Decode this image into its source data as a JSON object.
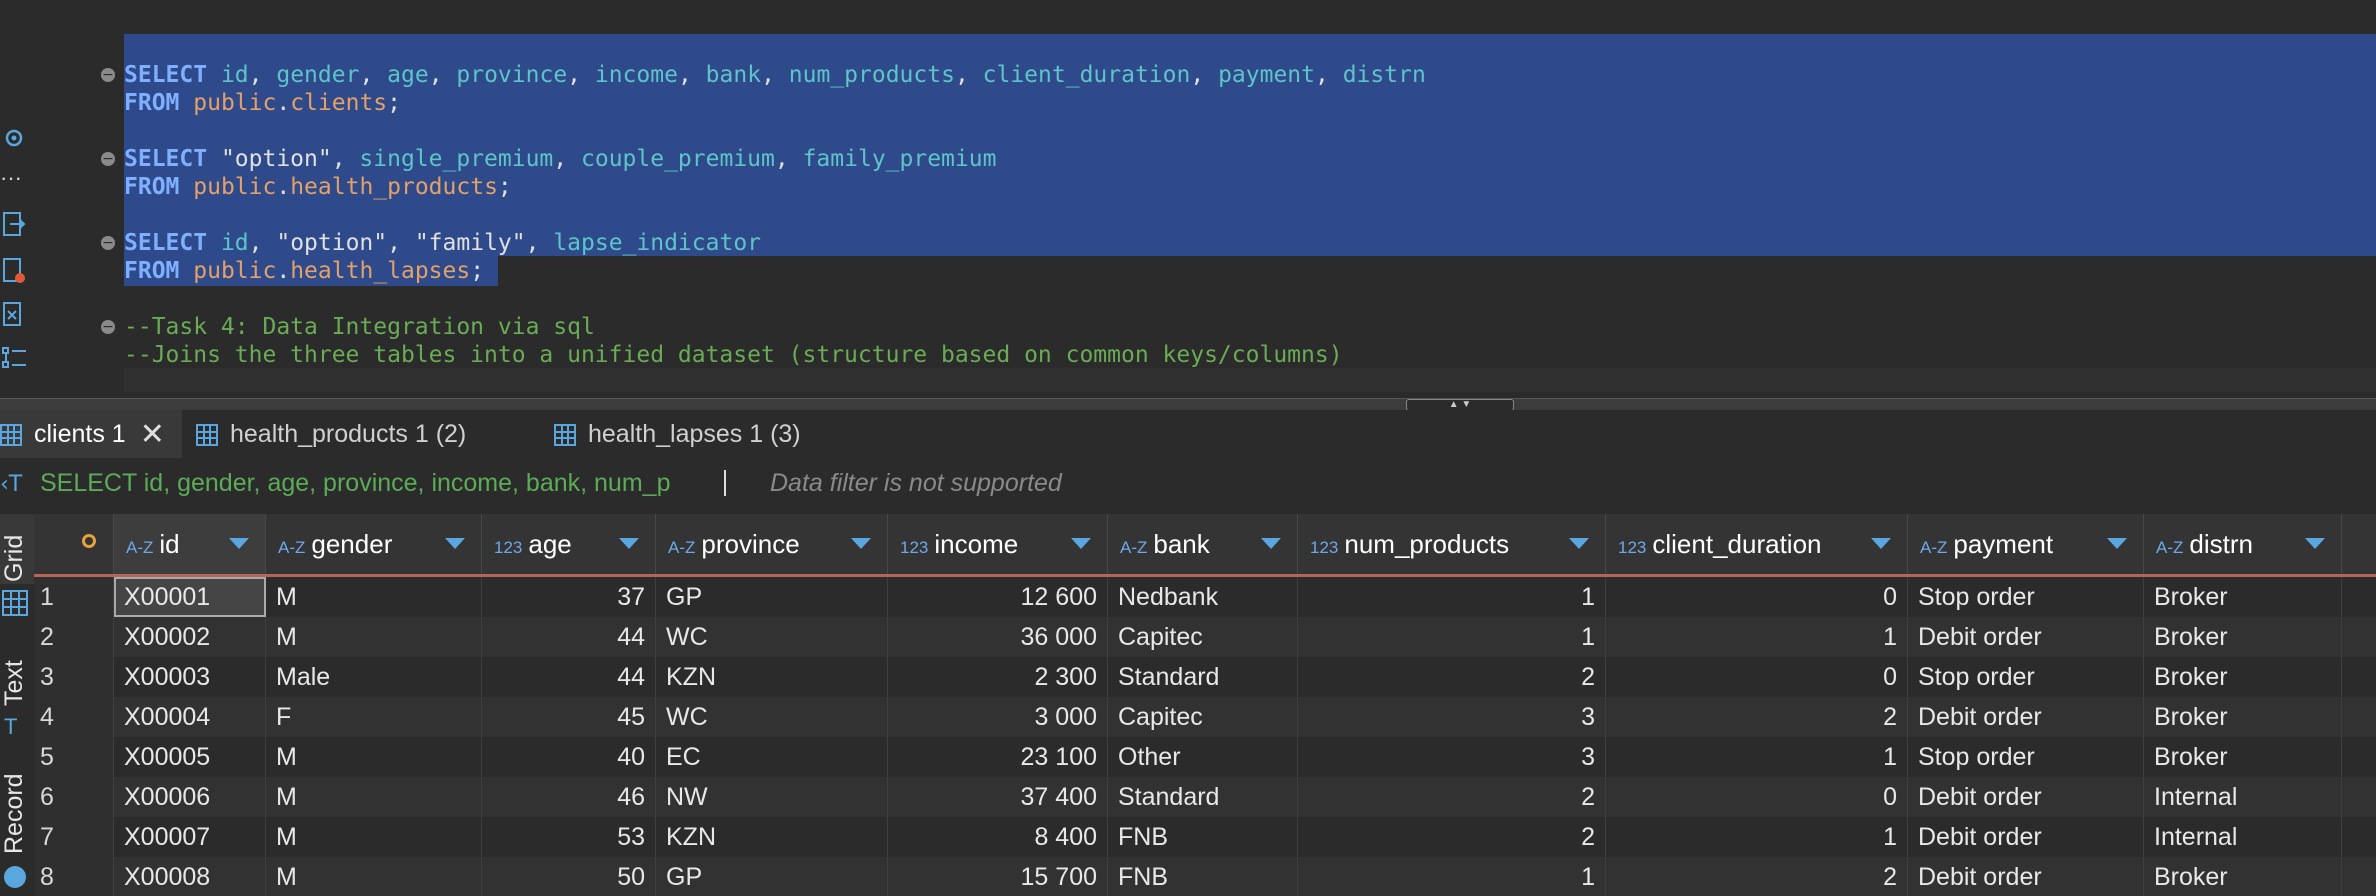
{
  "editor": {
    "lines": [
      {
        "parts": [
          [
            "kw",
            "SELECT "
          ],
          [
            "col",
            "id"
          ],
          [
            "plain",
            ", "
          ],
          [
            "col",
            "gender"
          ],
          [
            "plain",
            ", "
          ],
          [
            "col",
            "age"
          ],
          [
            "plain",
            ", "
          ],
          [
            "col",
            "province"
          ],
          [
            "plain",
            ", "
          ],
          [
            "col",
            "income"
          ],
          [
            "plain",
            ", "
          ],
          [
            "col",
            "bank"
          ],
          [
            "plain",
            ", "
          ],
          [
            "col",
            "num_products"
          ],
          [
            "plain",
            ", "
          ],
          [
            "col",
            "client_duration"
          ],
          [
            "plain",
            ", "
          ],
          [
            "col",
            "payment"
          ],
          [
            "plain",
            ", "
          ],
          [
            "col",
            "distrn"
          ]
        ]
      },
      {
        "parts": [
          [
            "kw",
            "FROM "
          ],
          [
            "tbl",
            "public"
          ],
          [
            "plain",
            "."
          ],
          [
            "tbl",
            "clients"
          ],
          [
            "plain",
            ";"
          ]
        ]
      },
      {
        "parts": [
          [
            "kw",
            "SELECT "
          ],
          [
            "str",
            "\"option\""
          ],
          [
            "plain",
            ", "
          ],
          [
            "col",
            "single_premium"
          ],
          [
            "plain",
            ", "
          ],
          [
            "col",
            "couple_premium"
          ],
          [
            "plain",
            ", "
          ],
          [
            "col",
            "family_premium"
          ]
        ]
      },
      {
        "parts": [
          [
            "kw",
            "FROM "
          ],
          [
            "tbl",
            "public"
          ],
          [
            "plain",
            "."
          ],
          [
            "tbl",
            "health_products"
          ],
          [
            "plain",
            ";"
          ]
        ]
      },
      {
        "parts": [
          [
            "kw",
            "SELECT "
          ],
          [
            "col",
            "id"
          ],
          [
            "plain",
            ", "
          ],
          [
            "str",
            "\"option\""
          ],
          [
            "plain",
            ", "
          ],
          [
            "str",
            "\"family\""
          ],
          [
            "plain",
            ", "
          ],
          [
            "col",
            "lapse_indicator"
          ]
        ]
      },
      {
        "parts": [
          [
            "kw",
            "FROM "
          ],
          [
            "tbl",
            "public"
          ],
          [
            "plain",
            "."
          ],
          [
            "tbl",
            "health_lapses"
          ],
          [
            "plain",
            ";"
          ]
        ]
      },
      {
        "parts": [
          [
            "cmt",
            "--Task 4: Data Integration via sql"
          ]
        ]
      },
      {
        "parts": [
          [
            "cmt",
            "--Joins the three tables into a unified dataset (structure based on common keys/columns)"
          ]
        ]
      }
    ]
  },
  "tabs": [
    {
      "label": "clients 1",
      "active": true,
      "closable": true
    },
    {
      "label": "health_products 1 (2)",
      "active": false
    },
    {
      "label": "health_lapses 1 (3)",
      "active": false
    }
  ],
  "filter": {
    "query": "SELECT id, gender, age, province, income, bank, num_p",
    "note": "Data filter is not supported"
  },
  "side_tabs": [
    "Grid",
    "Text",
    "Record"
  ],
  "grid": {
    "columns": [
      {
        "name": "id",
        "type": "A-Z"
      },
      {
        "name": "gender",
        "type": "A-Z"
      },
      {
        "name": "age",
        "type": "123"
      },
      {
        "name": "province",
        "type": "A-Z"
      },
      {
        "name": "income",
        "type": "123"
      },
      {
        "name": "bank",
        "type": "A-Z"
      },
      {
        "name": "num_products",
        "type": "123"
      },
      {
        "name": "client_duration",
        "type": "123"
      },
      {
        "name": "payment",
        "type": "A-Z"
      },
      {
        "name": "distrn",
        "type": "A-Z"
      }
    ],
    "rows": [
      [
        "1",
        "X00001",
        "M",
        "37",
        "GP",
        "12 600",
        "Nedbank",
        "1",
        "0",
        "Stop order",
        "Broker"
      ],
      [
        "2",
        "X00002",
        "M",
        "44",
        "WC",
        "36 000",
        "Capitec",
        "1",
        "1",
        "Debit order",
        "Broker"
      ],
      [
        "3",
        "X00003",
        "Male",
        "44",
        "KZN",
        "2 300",
        "Standard",
        "2",
        "0",
        "Stop order",
        "Broker"
      ],
      [
        "4",
        "X00004",
        "F",
        "45",
        "WC",
        "3 000",
        "Capitec",
        "3",
        "2",
        "Debit order",
        "Broker"
      ],
      [
        "5",
        "X00005",
        "M",
        "40",
        "EC",
        "23 100",
        "Other",
        "3",
        "1",
        "Stop order",
        "Broker"
      ],
      [
        "6",
        "X00006",
        "M",
        "46",
        "NW",
        "37 400",
        "Standard",
        "2",
        "0",
        "Debit order",
        "Internal"
      ],
      [
        "7",
        "X00007",
        "M",
        "53",
        "KZN",
        "8 400",
        "FNB",
        "2",
        "1",
        "Debit order",
        "Internal"
      ],
      [
        "8",
        "X00008",
        "M",
        "50",
        "GP",
        "15 700",
        "FNB",
        "1",
        "2",
        "Debit order",
        "Broker"
      ]
    ]
  }
}
